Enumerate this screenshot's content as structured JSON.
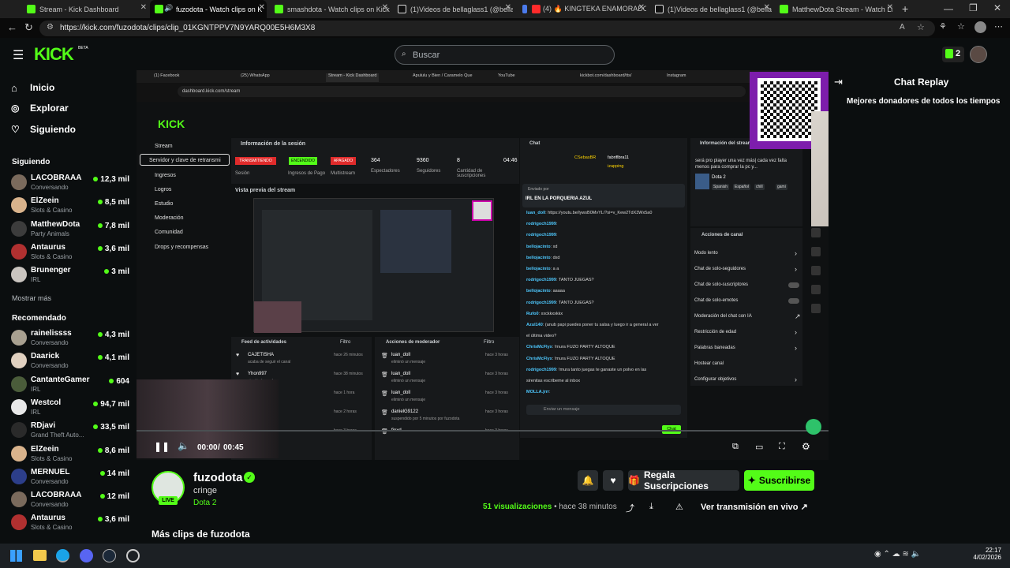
{
  "browser": {
    "tabs": [
      {
        "label": "Stream - Kick Dashboard",
        "color": "#53fc18"
      },
      {
        "label": "fuzodota - Watch clips on K",
        "color": "#53fc18",
        "active": true
      },
      {
        "label": "smashdota - Watch clips on Kick",
        "color": "#53fc18"
      },
      {
        "label": "(1)Videos de bellaglass1 (@bella",
        "color": "#ffffff"
      },
      {
        "label": "(4) 🔥 KINGTEKA ENAMORADO",
        "color": "#ff2b2b"
      },
      {
        "label": "(1)Videos de bellaglass1 (@bella",
        "color": "#ffffff"
      },
      {
        "label": "MatthewDota Stream - Watch Li",
        "color": "#53fc18"
      }
    ],
    "url": "https://kick.com/fuzodota/clips/clip_01KGNTPPV7N9YARQ00E5H6M3X8"
  },
  "header": {
    "logo": "KICK",
    "logo_badge": "BETA",
    "search_placeholder": "Buscar",
    "kicks_count": "2"
  },
  "sidebar": {
    "nav": [
      {
        "label": "Inicio",
        "icon": "home-icon"
      },
      {
        "label": "Explorar",
        "icon": "compass-icon"
      },
      {
        "label": "Siguiendo",
        "icon": "heart-icon"
      }
    ],
    "following_title": "Siguiendo",
    "following": [
      {
        "name": "LACOBRAAA",
        "category": "Conversando",
        "viewers": "12,3 mil",
        "color": "#7a6a5c"
      },
      {
        "name": "ElZeein",
        "category": "Slots & Casino",
        "viewers": "8,5 mil",
        "color": "#d9b38c"
      },
      {
        "name": "MatthewDota",
        "category": "Party Animals",
        "viewers": "7,8 mil",
        "color": "#3c3c3c"
      },
      {
        "name": "Antaurus",
        "category": "Slots & Casino",
        "viewers": "3,6 mil",
        "color": "#b03030"
      },
      {
        "name": "Brunenger",
        "category": "IRL",
        "viewers": "3 mil",
        "color": "#c9c4bf"
      }
    ],
    "show_more": "Mostrar más",
    "recommended_title": "Recomendado",
    "recommended": [
      {
        "name": "rainelissss",
        "category": "Conversando",
        "viewers": "4,3 mil",
        "color": "#a8a090"
      },
      {
        "name": "Daarick",
        "category": "Conversando",
        "viewers": "4,1 mil",
        "color": "#e0d0c0"
      },
      {
        "name": "CantanteGamer",
        "category": "IRL",
        "viewers": "604",
        "color": "#4a5c3a"
      },
      {
        "name": "Westcol",
        "category": "IRL",
        "viewers": "94,7 mil",
        "color": "#e8e8e8"
      },
      {
        "name": "RDjavi",
        "category": "Grand Theft Auto...",
        "viewers": "33,5 mil",
        "color": "#2a2a2a"
      },
      {
        "name": "ElZeein",
        "category": "Slots & Casino",
        "viewers": "8,6 mil",
        "color": "#d9b38c"
      },
      {
        "name": "MERNUEL",
        "category": "Conversando",
        "viewers": "14 mil",
        "color": "#2c3e8a"
      },
      {
        "name": "LACOBRAAA",
        "category": "Conversando",
        "viewers": "12 mil",
        "color": "#7a6a5c"
      },
      {
        "name": "Antaurus",
        "category": "Slots & Casino",
        "viewers": "3,6 mil",
        "color": "#b03030"
      }
    ]
  },
  "video": {
    "inner_tabs": [
      "(1) Facebook",
      "(25) WhatsApp",
      "Stream - Kick Dashboard",
      "Apululu y Bien / Caramelo Que",
      "YouTube",
      "kickbot.com/dashboard/tts/",
      "Instagram"
    ],
    "inner_url": "dashboard.kick.com/stream",
    "inner_logo": "KICK",
    "menu": [
      "Stream",
      "Servidor y clave de retransmi",
      "Ingresos",
      "Logros",
      "Estudio",
      "Moderación",
      "Comunidad",
      "Drops y recompensas"
    ],
    "session_title": "Información de la sesión",
    "session_badges": [
      "TRANSMITIENDO",
      "ENCENDIDO",
      "APAGADO"
    ],
    "session_stats": [
      {
        "value": "364",
        "label": "Espectadores"
      },
      {
        "value": "9360",
        "label": "Seguidores"
      },
      {
        "value": "8",
        "label": "Cantidad de suscripciones"
      },
      {
        "value": "04:46",
        "label": "Tiempo"
      }
    ],
    "session_labels": [
      "Sesión",
      "Ingresos de Pago",
      "Multistream"
    ],
    "preview_title": "Vista previa del stream",
    "activity_title": "Feed de actividades",
    "activity_filter": "Filtro",
    "activity": [
      {
        "name": "CAJETISHA",
        "desc": "acaba de seguir el canal",
        "time": "hace 26 minutos"
      },
      {
        "name": "Yhon997",
        "desc": "siguió el canal",
        "time": "hace 38 minutos"
      },
      {
        "name": "",
        "desc": "siguió el canal",
        "time": "hace 1 hora"
      },
      {
        "name": "",
        "desc": "siguió el canal",
        "time": "hace 2 horas"
      },
      {
        "name": "",
        "desc": "",
        "time": "hace 3 horas"
      }
    ],
    "mod_title": "Acciones de moderador",
    "mod_filter": "Filtro",
    "mod_actions": [
      {
        "name": "luan_doll",
        "desc": "eliminó un mensaje",
        "time": "hace 3 horas"
      },
      {
        "name": "luan_doll",
        "desc": "eliminó un mensaje",
        "time": "hace 3 horas"
      },
      {
        "name": "luan_doll",
        "desc": "eliminó un mensaje",
        "time": "hace 3 horas"
      },
      {
        "name": "danielG9122",
        "desc": "suspendido por 5 minutos por fuzodota",
        "time": "hace 3 horas"
      },
      {
        "name": "finxd",
        "desc": "",
        "time": "hace 3 horas"
      }
    ],
    "chat_title": "Chat",
    "chat_top": [
      "CSebasBR",
      "fabriflbra11",
      "izapping"
    ],
    "pinned_by": "Enviado por",
    "pinned_text": "IRL EN LA PORQUERIA AZUL",
    "chat": [
      {
        "user": "luan_doll",
        "msg": "https://youtu.be/lywsB0MvYL/?si=v_Kew2TdX3Wx5a0"
      },
      {
        "user": "rodrigoch1999",
        "msg": ""
      },
      {
        "user": "rodrigoch1999",
        "msg": ""
      },
      {
        "user": "bellojacinto",
        "msg": "xd"
      },
      {
        "user": "bellojacinto",
        "msg": "dxd"
      },
      {
        "user": "bellojacinto",
        "msg": "a a"
      },
      {
        "user": "rodrigoch1999",
        "msg": "TANTO JUEGAS?"
      },
      {
        "user": "bellojacinto",
        "msg": "aaaaa"
      },
      {
        "user": "rodrigoch1999",
        "msg": "TANTO JUEGAS?"
      },
      {
        "user": "Rufo0",
        "msg": "xxckkxxkkx"
      },
      {
        "user": "Azul140",
        "msg": "(anub papi puedes poner tu salsa y luego ir a general a ver"
      },
      {
        "user": "",
        "msg": "el última video?"
      },
      {
        "user": "ChrisMcFlyx",
        "msg": "!mura FUZO PARTY ALTOQUE"
      },
      {
        "user": "ChrisMcFlyx",
        "msg": "!mura FUZO PARTY ALTOQUE"
      },
      {
        "user": "rodrigoch1999",
        "msg": "!mura tanto juegas te ganaste un polvo en las"
      },
      {
        "user": "",
        "msg": "sirenitas escríbeme al inbox"
      },
      {
        "user": "MOLLA.jrrr",
        "msg": ""
      }
    ],
    "chat_placeholder": "Enviar un mensaje",
    "chat_button": "Chat",
    "info_title": "Información del stream",
    "info_text": "será pro player una vez más| cada vez falta menos para comprar la pc y...",
    "info_game": "Dota 2",
    "info_tags": [
      "Spanish",
      "Español",
      "chill",
      "gami"
    ],
    "channel_actions_title": "Acciones de canal",
    "channel_actions": [
      {
        "label": "Modo lento",
        "kind": "arrow"
      },
      {
        "label": "Chat de solo-seguidores",
        "kind": "arrow"
      },
      {
        "label": "Chat de solo-suscriptores",
        "kind": "toggle"
      },
      {
        "label": "Chat de solo-emotes",
        "kind": "toggle"
      },
      {
        "label": "Moderación del chat con IA",
        "kind": "link"
      },
      {
        "label": "Restricción de edad",
        "kind": "arrow"
      },
      {
        "label": "Palabras baneadas",
        "kind": "arrow"
      },
      {
        "label": "Hostear canal",
        "kind": "none"
      },
      {
        "label": "Configurar objetivos",
        "kind": "arrow"
      }
    ],
    "time_current": "00:00",
    "time_sep": "/",
    "time_total": "00:45",
    "progress_fraction": 0.0
  },
  "chat_replay": {
    "title": "Chat Replay",
    "subtitle": "Mejores donadores de todos los tiempos"
  },
  "clip": {
    "channel": "fuzodota",
    "title": "cringe",
    "game": "Dota 2",
    "live_badge": "LIVE",
    "gift_label": "Regala Suscripciones",
    "subscribe_label": "Suscribirse",
    "views_count": "51",
    "views_label": "visualizaciones",
    "time_ago": "hace 38 minutos",
    "watch_live": "Ver transmisión en vivo",
    "more_clips": "Más clips de fuzodota"
  },
  "taskbar": {
    "time": "22:17",
    "date": "4/02/2026"
  },
  "colors": {
    "kick_green": "#53fc18",
    "bg": "#0b0e0f"
  }
}
